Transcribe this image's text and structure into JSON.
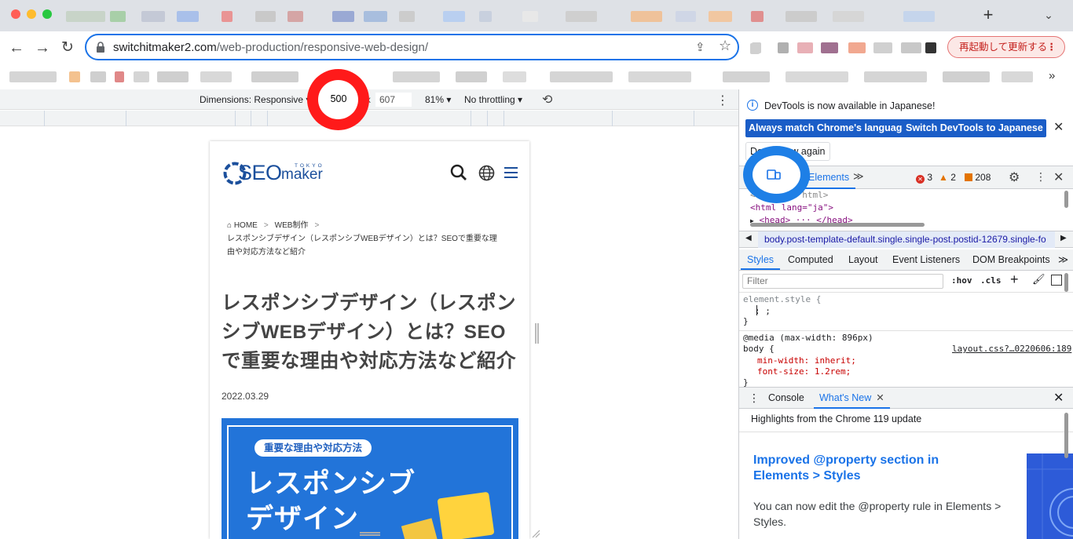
{
  "browser": {
    "url_host": "switchitmaker2.com",
    "url_path": "/web-production/responsive-web-design/",
    "restart_label": "再起動して更新する",
    "restart_more": "⋮",
    "new_tab": "+",
    "tab_dropdown": "⌄",
    "bookmarks_more": "»"
  },
  "device_toolbar": {
    "dimensions_label": "Dimensions: Responsive ▾",
    "width": "500",
    "times": "x",
    "height": "607",
    "zoom": "81% ▾",
    "throttling": "No throttling ▾"
  },
  "page": {
    "logo_seo": "SEO",
    "logo_maker": "maker",
    "logo_tokyo": "TOKYO",
    "breadcrumb": {
      "home": "HOME",
      "sep": ">",
      "category": "WEB制作",
      "current": "レスポンシブデザイン（レスポンシブWEBデザイン）とは？SEOで重要な理由や対応方法など紹介"
    },
    "title": "レスポンシブデザイン（レスポンシブWEBデザイン）とは？SEOで重要な理由や対応方法など紹介",
    "date": "2022.03.29",
    "hero": {
      "pill": "重要な理由や対応方法",
      "line1": "レスポンシブ",
      "line2": "デザイン"
    }
  },
  "devtools": {
    "infobar": {
      "message": "DevTools is now available in Japanese!",
      "btn_match": "Always match Chrome's language",
      "btn_switch": "Switch DevTools to Japanese",
      "dont_show": "Don't show again",
      "close": "✕"
    },
    "tabs": {
      "elements": "Elements",
      "more": "≫",
      "errors": "3",
      "warnings": "2",
      "issues": "208"
    },
    "dom": {
      "line0": "<!DOCTYPE html>",
      "html_open": "<html lang=\"ja\">",
      "head": "<head> ··· </head>"
    },
    "breadcrumb": "body.post-template-default.single.single-post.postid-12679.single-fo",
    "subtabs": {
      "styles": "Styles",
      "computed": "Computed",
      "layout": "Layout",
      "event_listeners": "Event Listeners",
      "dom_breakpoints": "DOM Breakpoints",
      "more": "≫"
    },
    "filter_placeholder": "Filter",
    "hov": ":hov",
    "cls": ".cls",
    "styles": {
      "element_style": "element.style {",
      "element_body": ": ;",
      "close": "}",
      "media": "@media (max-width: 896px)",
      "body_selector": "body {",
      "source": "layout.css?…0220606:189",
      "prop1": "min-width: inherit;",
      "prop2": "font-size: 1.2rem;"
    },
    "drawer": {
      "console": "Console",
      "whats_new": "What's New",
      "highlights": "Highlights from the Chrome 119 update",
      "article_title": "Improved @property section in Elements > Styles",
      "article_body": "You can now edit the @property rule in Elements > Styles."
    }
  },
  "colors": {
    "chrome_blue": "#1a73e8",
    "seo_blue": "#1b4f9c",
    "highlight_red": "#ff1a1a",
    "highlight_blue": "#1e7fe6"
  }
}
